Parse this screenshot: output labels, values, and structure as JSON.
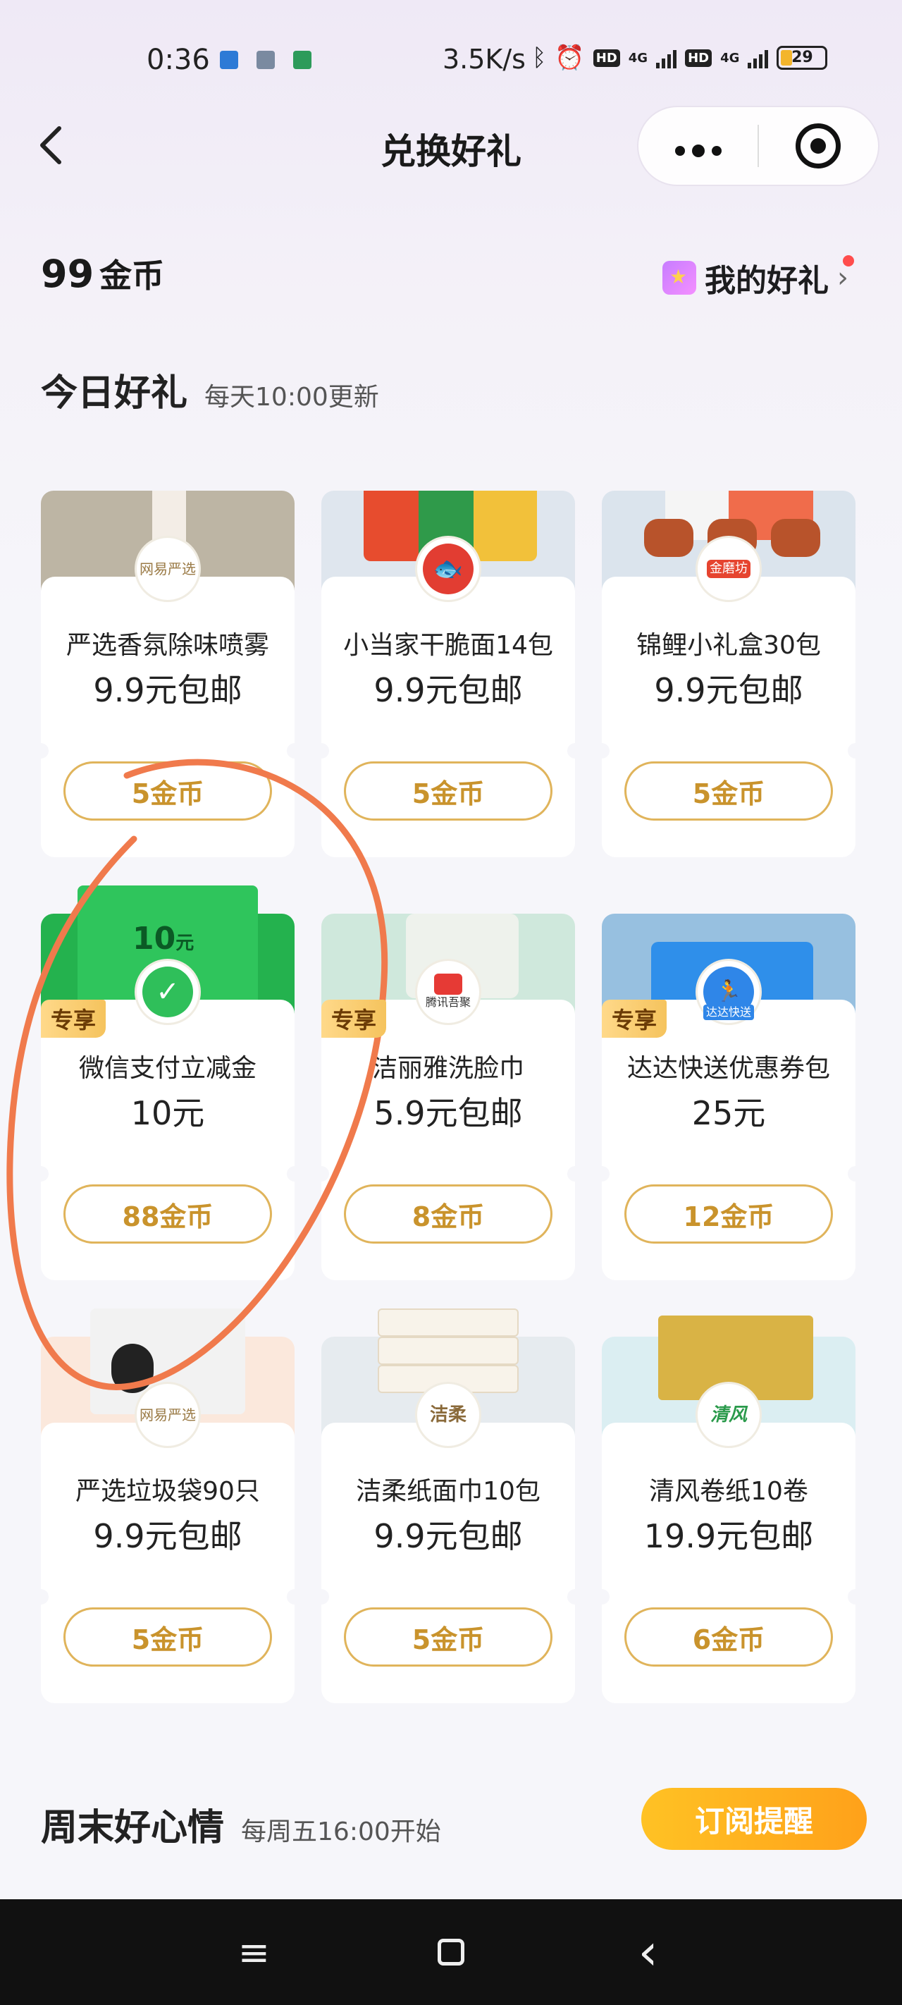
{
  "status_bar": {
    "time": "0:36",
    "network_speed": "3.5K/s",
    "hd1": "HD",
    "hd2": "HD",
    "signal1": "4G",
    "signal2": "4G",
    "battery": "29"
  },
  "header": {
    "back_icon": "chevron-left-icon",
    "title": "兑换好礼",
    "more_icon": "more-dots-icon",
    "close_icon": "target-circle-icon"
  },
  "account": {
    "coins_value": "99",
    "coins_unit": "金币",
    "my_gifts_label": "我的好礼",
    "my_gifts_icon": "gift-box-icon",
    "chevron": "›"
  },
  "today_section": {
    "title": "今日好礼",
    "subtitle": "每天10:00更新"
  },
  "products": [
    {
      "name": "严选香氛除味喷雾",
      "price": "9.9元包邮",
      "cost": "5金币",
      "badge": "",
      "logo_text": "网易严选",
      "image": "spray"
    },
    {
      "name": "小当家干脆面14包",
      "price": "9.9元包邮",
      "cost": "5金币",
      "badge": "",
      "logo_text": "",
      "image": "noodle"
    },
    {
      "name": "锦鲤小礼盒30包",
      "price": "9.9元包邮",
      "cost": "5金币",
      "badge": "",
      "logo_text": "金磨坊",
      "image": "snack"
    },
    {
      "name": "微信支付立减金",
      "price": "10元",
      "cost": "88金币",
      "badge": "专享",
      "logo_text": "",
      "image": "wechat",
      "image_amount": "10",
      "image_unit": "元"
    },
    {
      "name": "洁丽雅洗脸巾",
      "price": "5.9元包邮",
      "cost": "8金币",
      "badge": "专享",
      "logo_text": "腾讯吾聚",
      "image": "tissue"
    },
    {
      "name": "达达快送优惠券包",
      "price": "25元",
      "cost": "12金币",
      "badge": "专享",
      "logo_text": "达达快送",
      "image": "dada"
    },
    {
      "name": "严选垃圾袋90只",
      "price": "9.9元包邮",
      "cost": "5金币",
      "badge": "",
      "logo_text": "网易严选",
      "image": "bag"
    },
    {
      "name": "洁柔纸面巾10包",
      "price": "9.9元包邮",
      "cost": "5金币",
      "badge": "",
      "logo_text": "洁柔",
      "image": "face"
    },
    {
      "name": "清风卷纸10卷",
      "price": "19.9元包邮",
      "cost": "6金币",
      "badge": "",
      "logo_text": "清风",
      "image": "roll"
    }
  ],
  "weekend_section": {
    "title": "周末好心情",
    "subtitle": "每周五16:00开始",
    "subscribe_label": "订阅提醒"
  },
  "navbar": {
    "menu_icon": "≡",
    "home_icon": "",
    "back_icon": "‹"
  },
  "colors": {
    "accent_gold": "#c9932c",
    "subscribe_orange": "#ffa11a",
    "annotation_stroke": "#f07a4c"
  }
}
